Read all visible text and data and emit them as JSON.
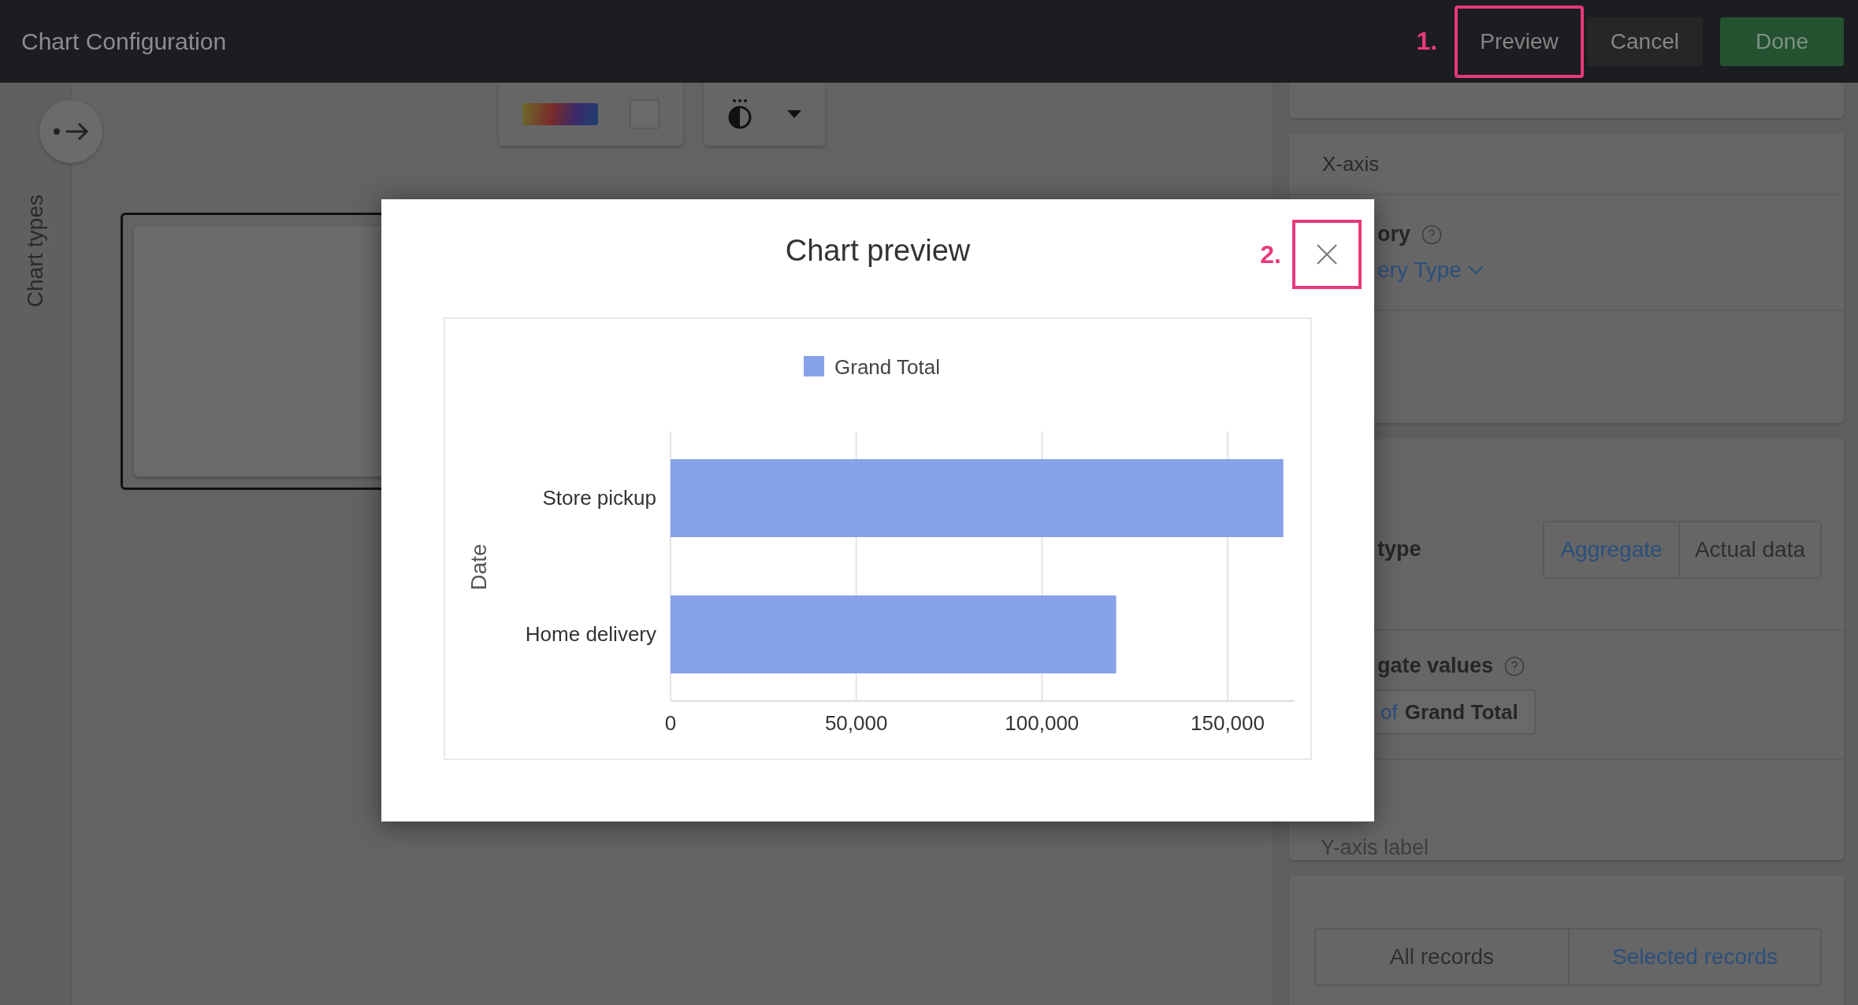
{
  "top_bar": {
    "title": "Chart Configuration",
    "annotation_number": "1.",
    "buttons": [
      {
        "label": "Preview",
        "kind": "plain",
        "annotated": true
      },
      {
        "label": "Cancel",
        "kind": "secondary",
        "annotated": false
      },
      {
        "label": "Done",
        "kind": "primary",
        "annotated": false
      }
    ]
  },
  "side_rail": {
    "label": "Chart types"
  },
  "settings": {
    "x_axis": {
      "title": "X-axis",
      "field_label": "ory",
      "field_value": "ery Type"
    },
    "type_row": {
      "label": "type",
      "options": [
        {
          "label": "Aggregate",
          "selected": true
        },
        {
          "label": "Actual data",
          "selected": false
        }
      ]
    },
    "aggregate": {
      "label": "gate values",
      "chip": {
        "prefix": "of",
        "field": "Grand Total"
      }
    },
    "y_axis_label": {
      "placeholder": "Y-axis label"
    },
    "records": {
      "options": [
        {
          "label": "All records",
          "selected": false
        },
        {
          "label": "Selected records",
          "selected": true
        }
      ]
    }
  },
  "modal": {
    "title": "Chart preview",
    "annotation_number": "2.",
    "chart_data": {
      "type": "bar",
      "orientation": "horizontal",
      "ylabel": "Date",
      "categories": [
        "Store pickup",
        "Home delivery"
      ],
      "series": [
        {
          "name": "Grand Total",
          "color": "#87a2e8",
          "values": [
            165000,
            120000
          ]
        }
      ],
      "xlim": [
        0,
        168000
      ],
      "grid": true,
      "xticks": [
        {
          "value": 0,
          "label": "0"
        },
        {
          "value": 50000,
          "label": "50,000"
        },
        {
          "value": 100000,
          "label": "100,000"
        },
        {
          "value": 150000,
          "label": "150,000"
        }
      ]
    }
  }
}
